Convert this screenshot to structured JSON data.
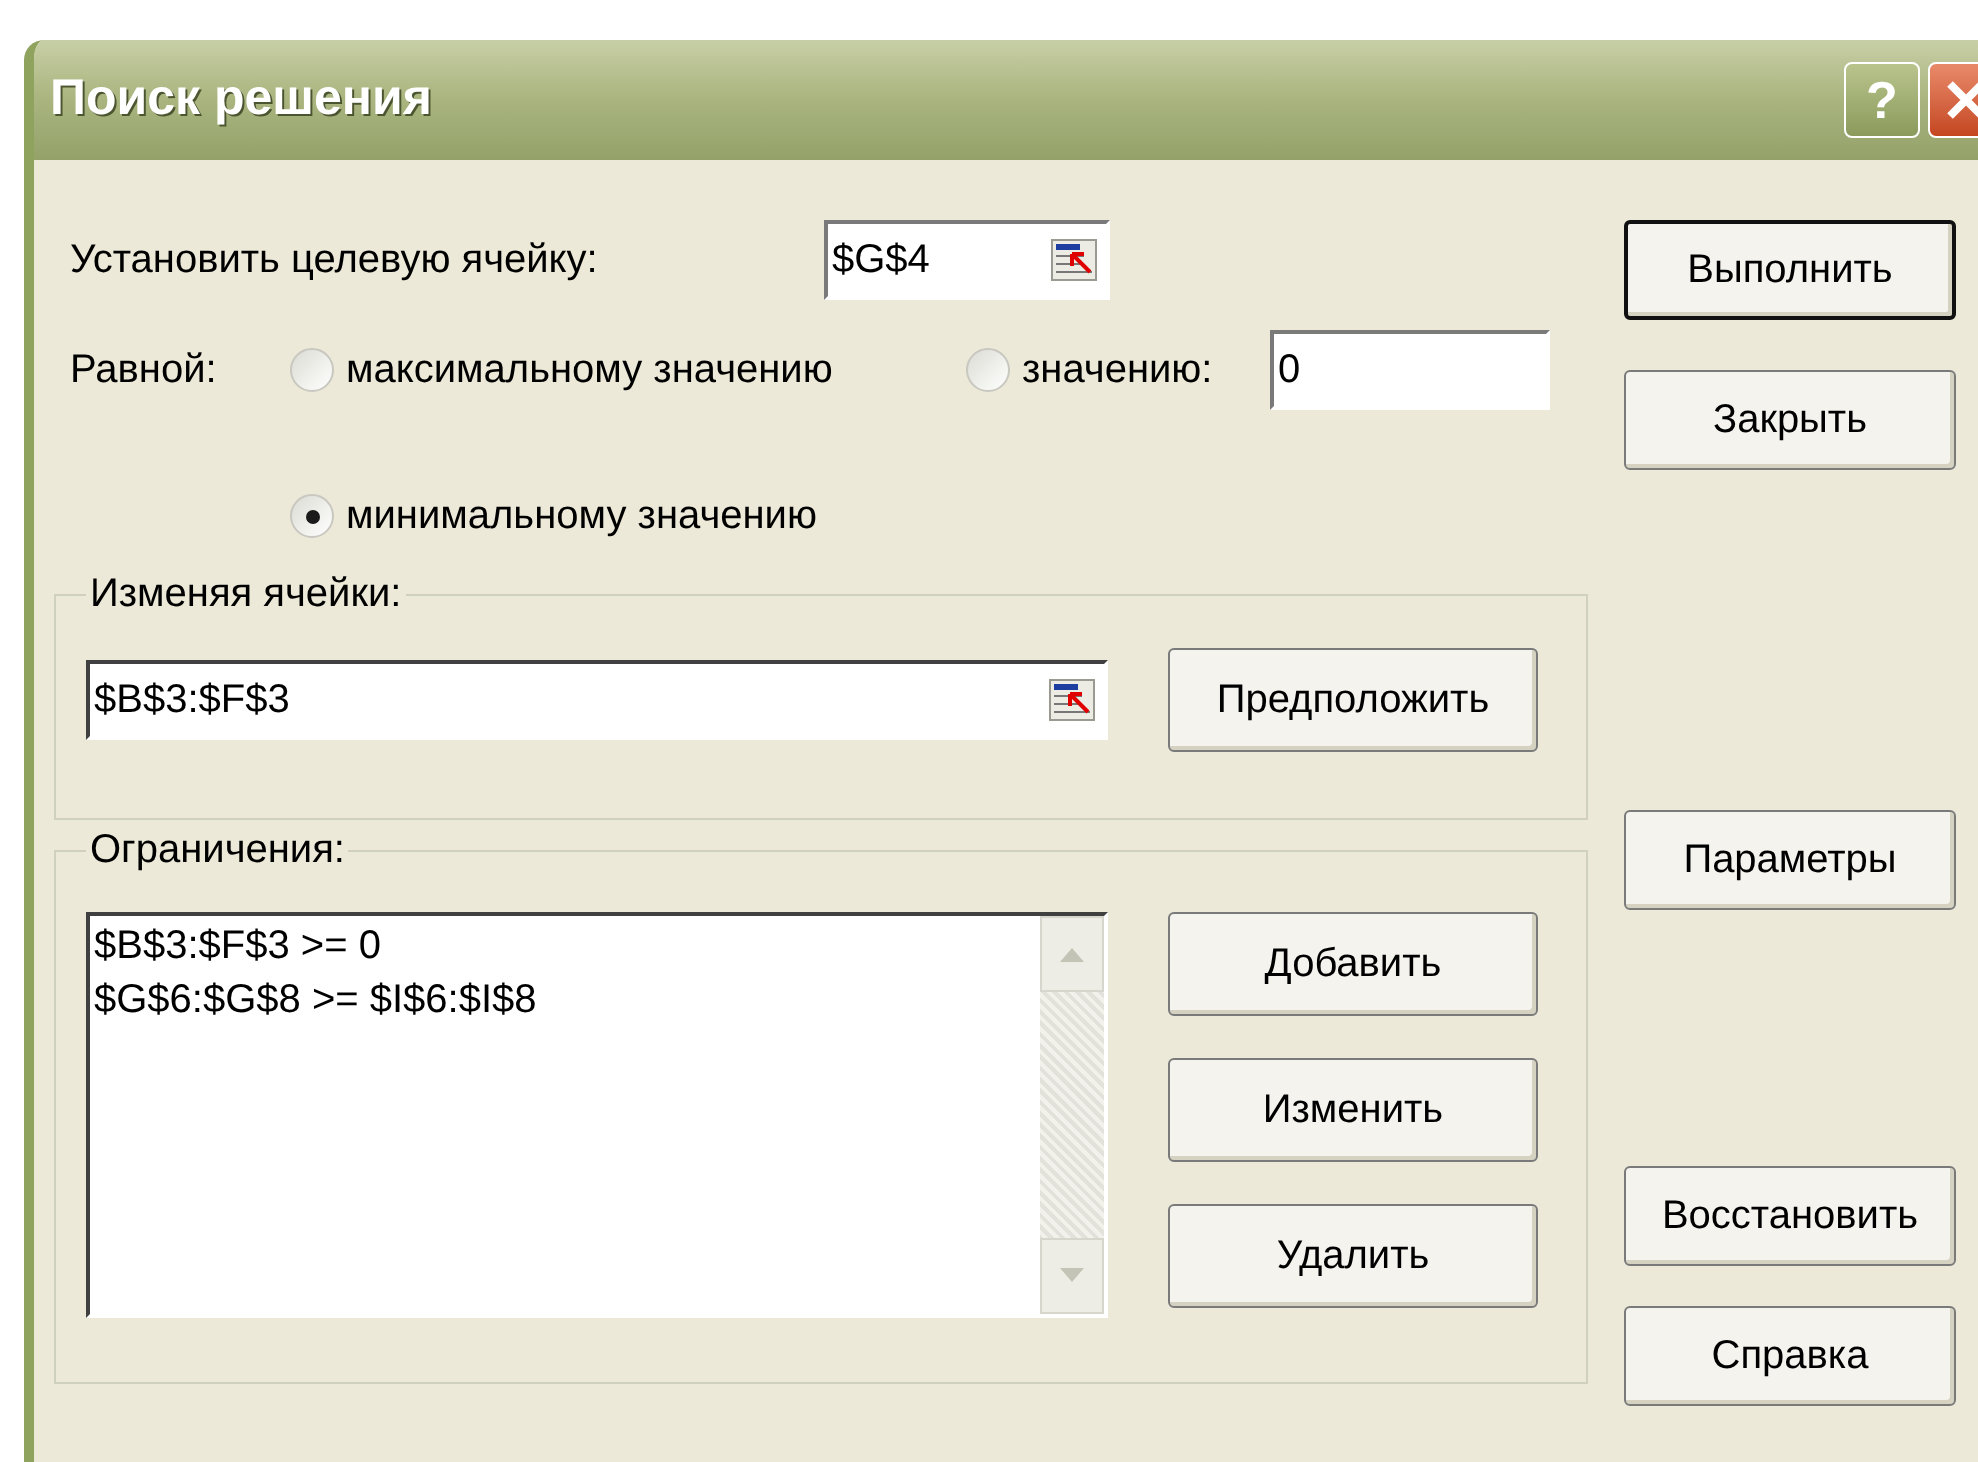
{
  "window": {
    "title": "Поиск решения",
    "help_button": "?"
  },
  "target": {
    "label": "Установить целевую ячейку:",
    "value": "$G$4"
  },
  "equal_to": {
    "label": "Равной:",
    "options": [
      {
        "label": "максимальному значению",
        "selected": false
      },
      {
        "label": "значению:",
        "selected": false
      },
      {
        "label": "минимальному значению",
        "selected": true
      }
    ],
    "value": "0"
  },
  "changing_cells": {
    "legend": "Изменяя ячейки:",
    "value": "$B$3:$F$3",
    "button": "Предположить"
  },
  "constraints": {
    "legend": "Ограничения:",
    "items": [
      "$B$3:$F$3 >= 0",
      "$G$6:$G$8 >= $I$6:$I$8"
    ],
    "buttons": [
      "Добавить",
      "Изменить",
      "Удалить"
    ]
  },
  "side_buttons": [
    {
      "label": "Выполнить",
      "default": true
    },
    {
      "label": "Закрыть",
      "default": false
    },
    {
      "label": "Параметры",
      "default": false
    },
    {
      "label": "Восстановить",
      "default": false
    },
    {
      "label": "Справка",
      "default": false
    }
  ]
}
